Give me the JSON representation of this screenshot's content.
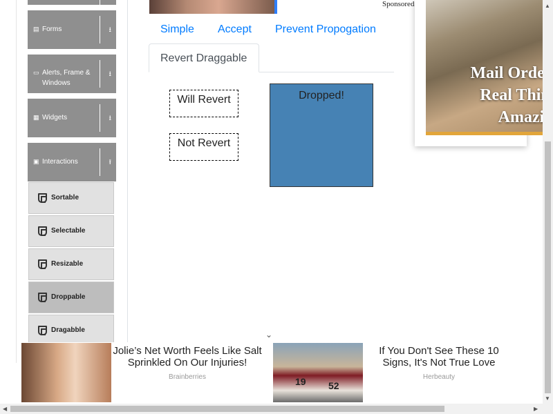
{
  "sidebar": {
    "groups": [
      {
        "label": "Forms",
        "icon": "form-icon"
      },
      {
        "label": "Alerts, Frame & Windows",
        "icon": "window-icon"
      },
      {
        "label": "Widgets",
        "icon": "widgets-icon"
      },
      {
        "label": "Interactions",
        "icon": "interactions-icon"
      }
    ],
    "items": [
      {
        "label": "Sortable"
      },
      {
        "label": "Selectable"
      },
      {
        "label": "Resizable"
      },
      {
        "label": "Droppable",
        "active": true
      },
      {
        "label": "Dragabble"
      }
    ]
  },
  "tabs": {
    "simple": "Simple",
    "accept": "Accept",
    "prevent": "Prevent Propogation",
    "revert": "Revert Draggable"
  },
  "demo": {
    "will_revert": "Will Revert",
    "not_revert": "Not Revert",
    "drop_label": "Dropped!"
  },
  "top_ad": {
    "sponsored": "Sponsored"
  },
  "side_ad": {
    "lines": [
      "Mail Order W",
      "Real Thing,",
      "Amazi"
    ]
  },
  "bottom_ad": {
    "story1": {
      "title": "Jolie’s Net Worth Feels Like Salt Sprinkled On Our Injuries!",
      "source": "Brainberries"
    },
    "story2": {
      "title": "If You Don't See These 10 Signs, It's Not True Love",
      "source": "Herbeauty",
      "jersey_left": "19",
      "jersey_right": "52"
    }
  },
  "colors": {
    "accent": "#007bff",
    "drop_fill": "#4682b4",
    "sidebar_header": "#8f8f8f"
  }
}
